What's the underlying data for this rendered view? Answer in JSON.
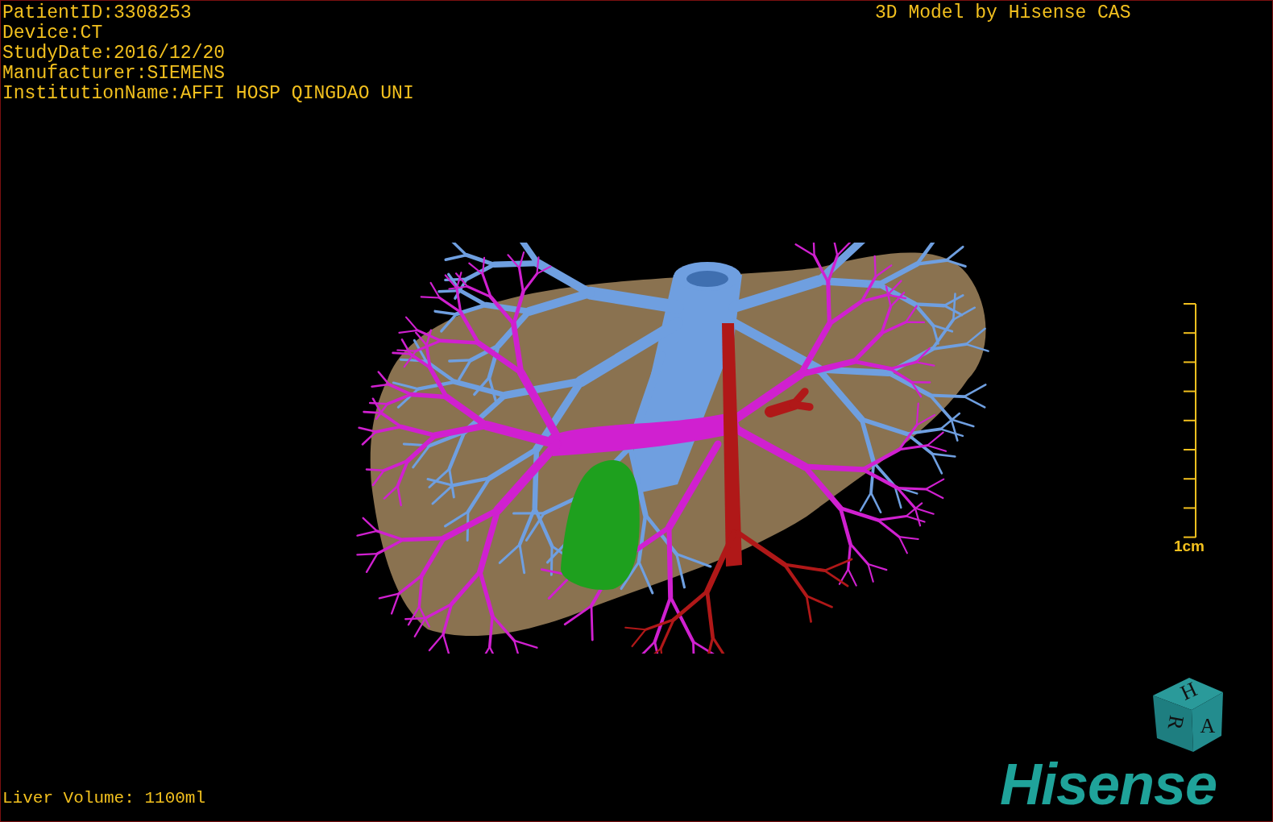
{
  "patient_info": [
    "PatientID:3308253",
    "Device:CT",
    "StudyDate:2016/12/20",
    "Manufacturer:SIEMENS",
    "InstitutionName:AFFI HOSP QINGDAO UNI"
  ],
  "title": "3D Model by Hisense CAS",
  "scale_bar": {
    "label": "1cm"
  },
  "orientation_cube": {
    "labels": [
      "H",
      "R",
      "A"
    ]
  },
  "logo": {
    "text": "Hisense"
  },
  "footer": "Liver Volume: 1100ml"
}
